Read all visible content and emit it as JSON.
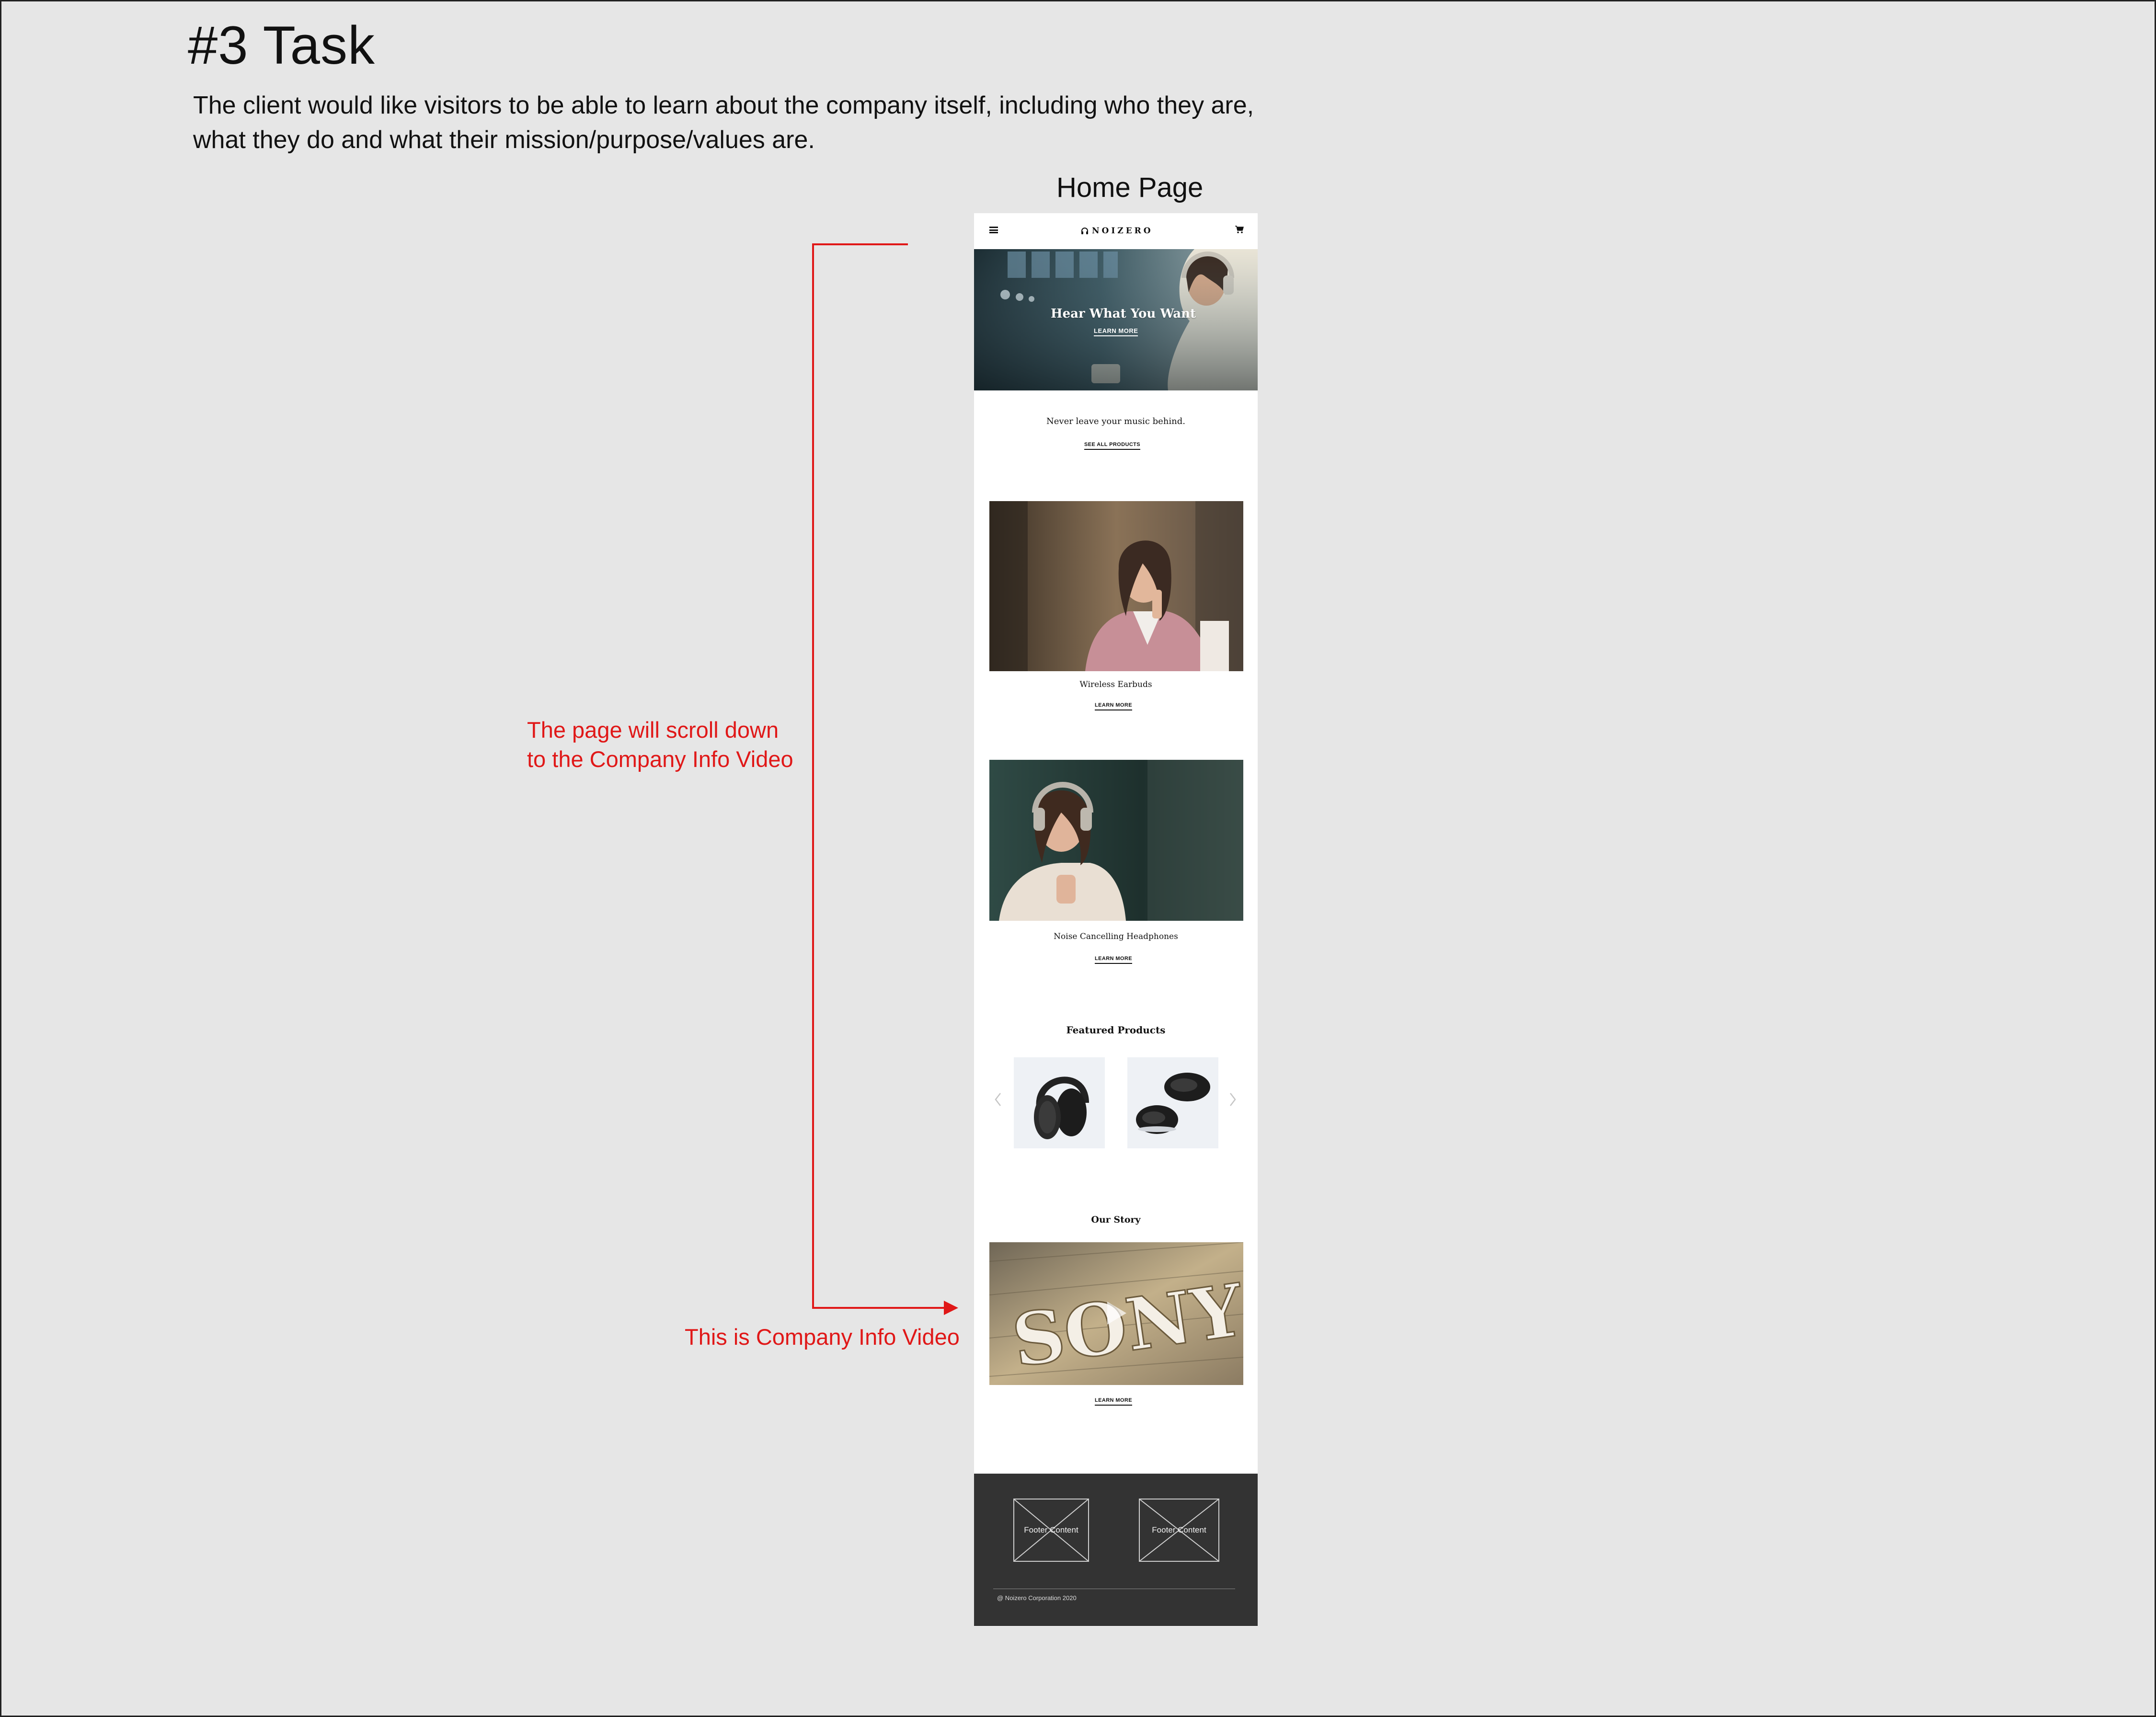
{
  "task": {
    "title": "#3 Task",
    "description_lines": [
      "The client would like visitors to be able to learn about the company itself, including who they are,",
      "what they do and what their mission/purpose/values are."
    ]
  },
  "screen_label": "Home Page",
  "annotations": {
    "scroll_lines": [
      "The page will scroll down",
      "to the Company Info Video"
    ],
    "video_note": "This is Company Info Video",
    "color": "#e01818"
  },
  "mockup": {
    "nav": {
      "menu_icon": "hamburger-icon",
      "logo_icon": "headphones-icon",
      "logo_text": "NOIZERO",
      "cart_icon": "cart-icon"
    },
    "hero": {
      "title": "Hear What You Want",
      "link": "LEARN MORE"
    },
    "intro": {
      "tagline": "Never leave your music behind.",
      "link": "SEE ALL PRODUCTS"
    },
    "promo_earbuds": {
      "caption": "Wireless Earbuds",
      "link": "LEARN MORE"
    },
    "promo_headphones": {
      "caption": "Noise Cancelling Headphones",
      "link": "LEARN MORE"
    },
    "featured": {
      "title": "Featured Products",
      "prev_icon": "chevron-left-icon",
      "next_icon": "chevron-right-icon"
    },
    "story": {
      "title": "Our Story",
      "video_sign_text": "SONY",
      "play_icon": "play-icon",
      "link": "LEARN MORE"
    },
    "footer": {
      "box_1": "Footer Content",
      "box_2": "Footer Content",
      "copyright": "@ Noizero Corporation 2020"
    }
  }
}
